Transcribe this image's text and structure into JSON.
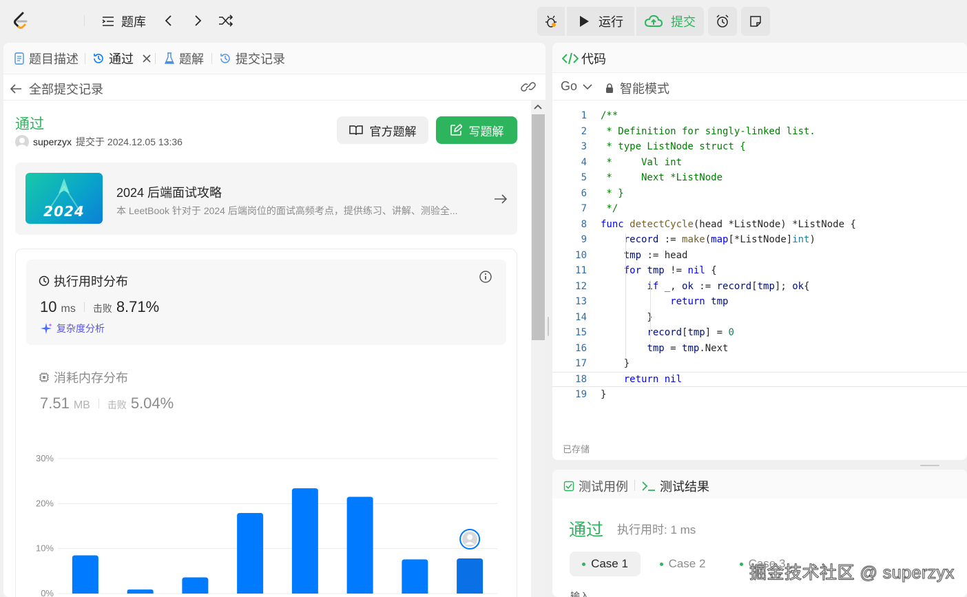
{
  "topbar": {
    "problem_bank": "题库",
    "run": "运行",
    "submit": "提交"
  },
  "left_tabs": [
    {
      "label": "题目描述"
    },
    {
      "label": "通过"
    },
    {
      "label": "题解"
    },
    {
      "label": "提交记录"
    }
  ],
  "back_label": "全部提交记录",
  "submission": {
    "status": "通过",
    "user": "superzyx",
    "submitted_at": "提交于 2024.12.05 13:36",
    "official_solution": "官方题解",
    "write_solution": "写题解"
  },
  "promo": {
    "badge": "2024",
    "title": "2024 后端面试攻略",
    "desc": "本 LeetBook 针对于 2024 后端岗位的面试高频考点，提供练习、讲解、测验全..."
  },
  "runtime": {
    "title": "执行用时分布",
    "value": "10",
    "unit": "ms",
    "beat_label": "击败",
    "beat": "8.71%",
    "complexity": "复杂度分析"
  },
  "memory": {
    "title": "消耗内存分布",
    "value": "7.51",
    "unit": "MB",
    "beat_label": "击败",
    "beat": "5.04%"
  },
  "chart_data": {
    "type": "bar",
    "y_ticks": [
      "30%",
      "20%",
      "10%",
      "0%"
    ],
    "ylim": [
      0,
      30
    ],
    "values": [
      8.5,
      0.9,
      3.6,
      17.9,
      23.4,
      21.5,
      7.6,
      7.8
    ],
    "highlight_index": 7,
    "colors": {
      "bar": "#007aff",
      "grid": "#ebebeb"
    }
  },
  "editor": {
    "title": "代码",
    "language": "Go",
    "mode": "智能模式",
    "saved": "已存储"
  },
  "code": [
    "/**",
    " * Definition for singly-linked list.",
    " * type ListNode struct {",
    " *     Val int",
    " *     Next *ListNode",
    " * }",
    " */",
    "func detectCycle(head *ListNode) *ListNode {",
    "    record := make(map[*ListNode]int)",
    "    tmp := head",
    "    for tmp != nil {",
    "        if _, ok := record[tmp]; ok{",
    "            return tmp",
    "        }",
    "        record[tmp] = 0",
    "        tmp = tmp.Next",
    "    }",
    "    return nil",
    "}"
  ],
  "bottom": {
    "tab_cases": "测试用例",
    "tab_result": "测试结果",
    "status": "通过",
    "runtime": "执行用时: 1 ms",
    "case1": "Case 1",
    "case2": "Case 2",
    "case3": "Case 3",
    "input_label": "输入"
  },
  "watermark": "掘金技术社区 @ superzyx",
  "colors": {
    "accent_green": "#2db55d",
    "blue": "#007aff",
    "submit_green": "#2db55d"
  }
}
